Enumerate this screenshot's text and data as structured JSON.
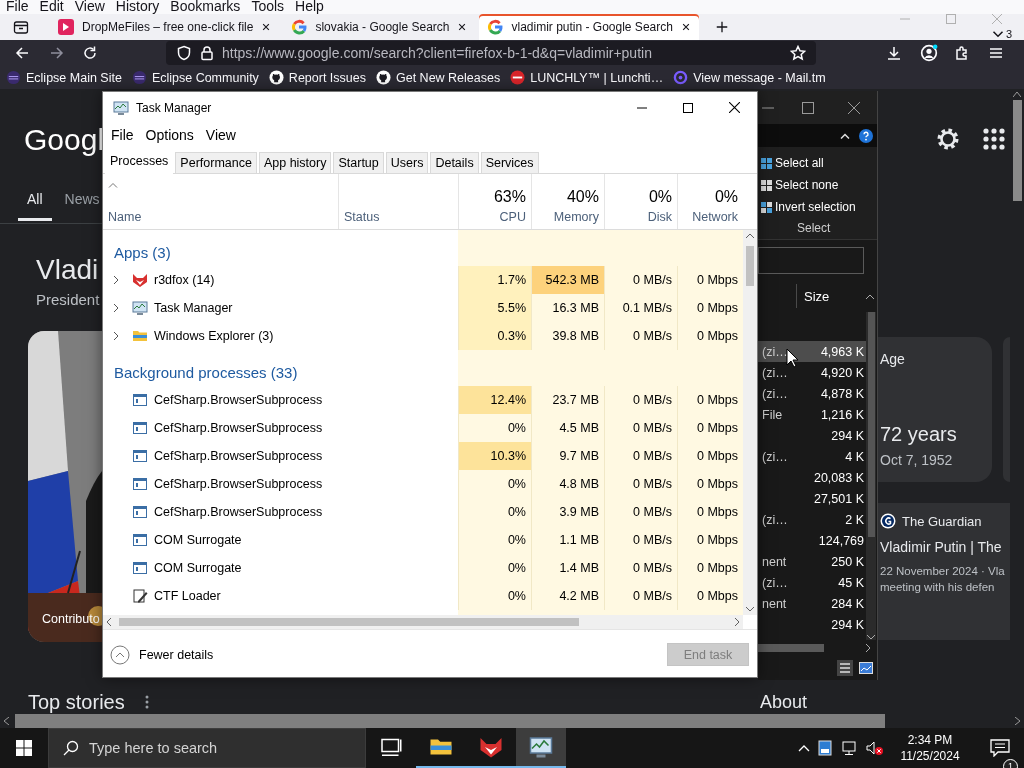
{
  "browser": {
    "menu": [
      "File",
      "Edit",
      "View",
      "History",
      "Bookmarks",
      "Tools",
      "Help"
    ],
    "tabs": [
      {
        "title": "DropMeFiles – free one-click file",
        "kind": "dropme",
        "selected": false
      },
      {
        "title": "slovakia - Google Search",
        "kind": "google",
        "selected": false
      },
      {
        "title": "vladimir putin - Google Search",
        "kind": "google",
        "selected": true
      }
    ],
    "tab_count": "3",
    "url": "https://www.google.com/search?client=firefox-b-1-d&q=vladimir+putin",
    "bookmarks": [
      {
        "label": "Eclipse Main Site",
        "kind": "eclipse"
      },
      {
        "label": "Eclipse Community",
        "kind": "eclipse"
      },
      {
        "label": "Report Issues",
        "kind": "github"
      },
      {
        "label": "Get New Releases",
        "kind": "github"
      },
      {
        "label": "LUNCHLY™ | Lunchti…",
        "kind": "lunchly"
      },
      {
        "label": "View message - Mail.tm",
        "kind": "mailtm"
      }
    ]
  },
  "google": {
    "logo": "Googl",
    "nav": [
      {
        "label": "All",
        "selected": true
      },
      {
        "label": "News",
        "selected": false
      }
    ],
    "title": "Vladi",
    "subtitle": "President",
    "photo_caption": "Contributo",
    "age_label": "Age",
    "age_value": "72 years",
    "birth_date": "Oct 7, 1952",
    "news_source": "The Guardian",
    "news_title": "Vladimir Putin | The",
    "news_snippet": [
      "22 November 2024 · Vla",
      "meeting with his defen"
    ],
    "top_stories": "Top stories",
    "about": "About"
  },
  "explorer": {
    "ribbon": [
      {
        "label": "Select all",
        "kind": "select-all"
      },
      {
        "label": "Select none",
        "kind": "select-none"
      },
      {
        "label": "Invert selection",
        "kind": "invert"
      }
    ],
    "ribbon_group": "Select",
    "size_header": "Size",
    "rows": [
      {
        "type": "(zi…",
        "size": "4,963 K",
        "selected": true
      },
      {
        "type": "(zi…",
        "size": "4,920 K",
        "selected": false
      },
      {
        "type": "(zi…",
        "size": "4,878 K",
        "selected": false
      },
      {
        "type": "File",
        "size": "1,216 K",
        "selected": false
      },
      {
        "size": "294 K",
        "selected": false
      },
      {
        "type": "(zi…",
        "size": "4 K",
        "selected": false
      },
      {
        "size": "20,083 K",
        "selected": false
      },
      {
        "size": "27,501 K",
        "selected": false
      },
      {
        "type": "(zi…",
        "size": "2 K",
        "selected": false
      },
      {
        "size": "124,769",
        "selected": false
      },
      {
        "type": "nent",
        "size": "250 K",
        "selected": false
      },
      {
        "type": "(zi…",
        "size": "45 K",
        "selected": false
      },
      {
        "type": "nent",
        "size": "284 K",
        "selected": false
      },
      {
        "size": "294 K",
        "selected": false
      }
    ]
  },
  "task_manager": {
    "title": "Task Manager",
    "menu": [
      "File",
      "Options",
      "View"
    ],
    "tabs": [
      {
        "label": "Processes",
        "selected": true
      },
      {
        "label": "Performance",
        "selected": false
      },
      {
        "label": "App history",
        "selected": false
      },
      {
        "label": "Startup",
        "selected": false
      },
      {
        "label": "Users",
        "selected": false
      },
      {
        "label": "Details",
        "selected": false
      },
      {
        "label": "Services",
        "selected": false
      }
    ],
    "columns": [
      {
        "label": "Name",
        "sorted": true
      },
      {
        "label": "Status",
        "sorted": false
      },
      {
        "label": "CPU",
        "total": "63%",
        "sorted": false
      },
      {
        "label": "Memory",
        "total": "40%",
        "sorted": false
      },
      {
        "label": "Disk",
        "total": "0%",
        "sorted": false
      },
      {
        "label": "Network",
        "total": "0%",
        "sorted": false
      }
    ],
    "sections": [
      {
        "title": "Apps (3)",
        "rows": [
          {
            "name": "r3dfox (14)",
            "kind": "fox",
            "expandable": true,
            "cells": [
              {
                "text": "1.7%",
                "color": "#fff1bd"
              },
              {
                "text": "542.3 MB",
                "color": "#fdd27c"
              },
              {
                "text": "0 MB/s"
              },
              {
                "text": "0 Mbps"
              }
            ]
          },
          {
            "name": "Task Manager",
            "kind": "taskmgr",
            "expandable": true,
            "cells": [
              {
                "text": "5.5%",
                "color": "#fff1bd"
              },
              {
                "text": "16.3 MB"
              },
              {
                "text": "0.1 MB/s"
              },
              {
                "text": "0 Mbps"
              }
            ]
          },
          {
            "name": "Windows Explorer (3)",
            "kind": "explorer",
            "expandable": true,
            "cells": [
              {
                "text": "0.3%",
                "color": "#fff1bd"
              },
              {
                "text": "39.8 MB"
              },
              {
                "text": "0 MB/s"
              },
              {
                "text": "0 Mbps"
              }
            ]
          }
        ]
      },
      {
        "title": "Background processes (33)",
        "rows": [
          {
            "name": "CefSharp.BrowserSubprocess",
            "kind": "app",
            "expandable": false,
            "cells": [
              {
                "text": "12.4%",
                "color": "#fde39a"
              },
              {
                "text": "23.7 MB"
              },
              {
                "text": "0 MB/s"
              },
              {
                "text": "0 Mbps"
              }
            ]
          },
          {
            "name": "CefSharp.BrowserSubprocess",
            "kind": "app",
            "expandable": false,
            "cells": [
              {
                "text": "0%"
              },
              {
                "text": "4.5 MB"
              },
              {
                "text": "0 MB/s"
              },
              {
                "text": "0 Mbps"
              }
            ]
          },
          {
            "name": "CefSharp.BrowserSubprocess",
            "kind": "app",
            "expandable": false,
            "cells": [
              {
                "text": "10.3%",
                "color": "#fde39a"
              },
              {
                "text": "9.7 MB"
              },
              {
                "text": "0 MB/s"
              },
              {
                "text": "0 Mbps"
              }
            ]
          },
          {
            "name": "CefSharp.BrowserSubprocess",
            "kind": "app",
            "expandable": false,
            "cells": [
              {
                "text": "0%"
              },
              {
                "text": "4.8 MB"
              },
              {
                "text": "0 MB/s"
              },
              {
                "text": "0 Mbps"
              }
            ]
          },
          {
            "name": "CefSharp.BrowserSubprocess",
            "kind": "app",
            "expandable": false,
            "cells": [
              {
                "text": "0%"
              },
              {
                "text": "3.9 MB"
              },
              {
                "text": "0 MB/s"
              },
              {
                "text": "0 Mbps"
              }
            ]
          },
          {
            "name": "COM Surrogate",
            "kind": "app",
            "expandable": false,
            "cells": [
              {
                "text": "0%"
              },
              {
                "text": "1.1 MB"
              },
              {
                "text": "0 MB/s"
              },
              {
                "text": "0 Mbps"
              }
            ]
          },
          {
            "name": "COM Surrogate",
            "kind": "app",
            "expandable": false,
            "cells": [
              {
                "text": "0%"
              },
              {
                "text": "1.4 MB"
              },
              {
                "text": "0 MB/s"
              },
              {
                "text": "0 Mbps"
              }
            ]
          },
          {
            "name": "CTF Loader",
            "kind": "ctf",
            "expandable": false,
            "cells": [
              {
                "text": "0%"
              },
              {
                "text": "4.2 MB"
              },
              {
                "text": "0 MB/s"
              },
              {
                "text": "0 Mbps"
              }
            ]
          }
        ]
      }
    ],
    "details_toggle": "Fewer details",
    "end_task": {
      "label": "End task",
      "disabled": true
    }
  },
  "taskbar": {
    "search_placeholder": "Type here to search",
    "apps": [
      {
        "kind": "taskview",
        "running": false,
        "active": false
      },
      {
        "kind": "explorer",
        "running": true,
        "active": false
      },
      {
        "kind": "fox",
        "running": true,
        "active": false
      },
      {
        "kind": "taskmgr",
        "running": true,
        "active": true
      }
    ],
    "time": "2:34 PM",
    "date": "11/25/2024",
    "notifications": "1"
  }
}
